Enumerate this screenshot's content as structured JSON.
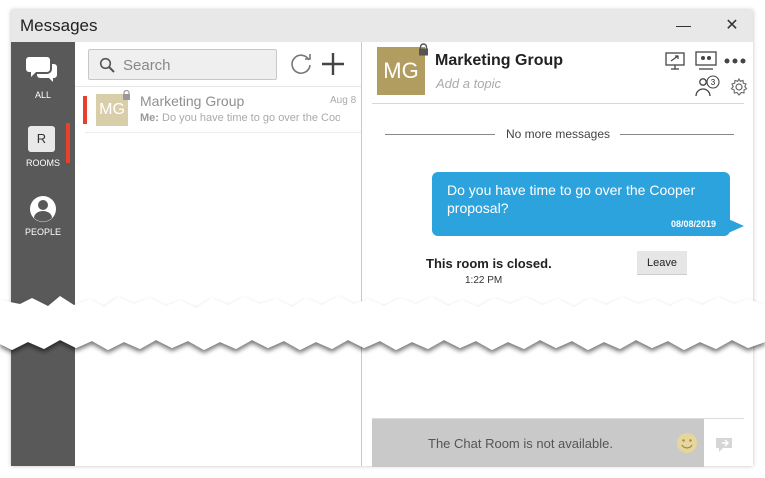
{
  "window": {
    "title": "Messages",
    "minimize_label": "—",
    "close_label": "✕"
  },
  "rail": {
    "items": [
      {
        "label": "ALL",
        "icon": "chat-bubbles-icon"
      },
      {
        "label": "ROOMS",
        "icon": "room-box-icon",
        "glyph": "R",
        "active": true
      },
      {
        "label": "PEOPLE",
        "icon": "person-icon"
      }
    ]
  },
  "list": {
    "search_placeholder": "Search",
    "items": [
      {
        "name": "Marketing Group",
        "initials": "MG",
        "date": "Aug 8",
        "preview_prefix": "Me:",
        "preview": "Do you have time to go over the Cooper proposal?"
      }
    ]
  },
  "chat": {
    "room_initials": "MG",
    "room_name": "Marketing Group",
    "topic_placeholder": "Add a topic",
    "participant_count": "3",
    "no_more": "No more messages",
    "message": {
      "text": "Do you have time to go over the Cooper proposal?",
      "date": "08/08/2019"
    },
    "closed_notice": "This room is closed.",
    "closed_time": "1:22 PM",
    "leave_label": "Leave",
    "unavailable": "The Chat Room is not available."
  },
  "colors": {
    "accent_blue": "#2da3de",
    "unread_red": "#e8412b",
    "rail_gray": "#595959",
    "room_gold": "#b19d5f"
  }
}
